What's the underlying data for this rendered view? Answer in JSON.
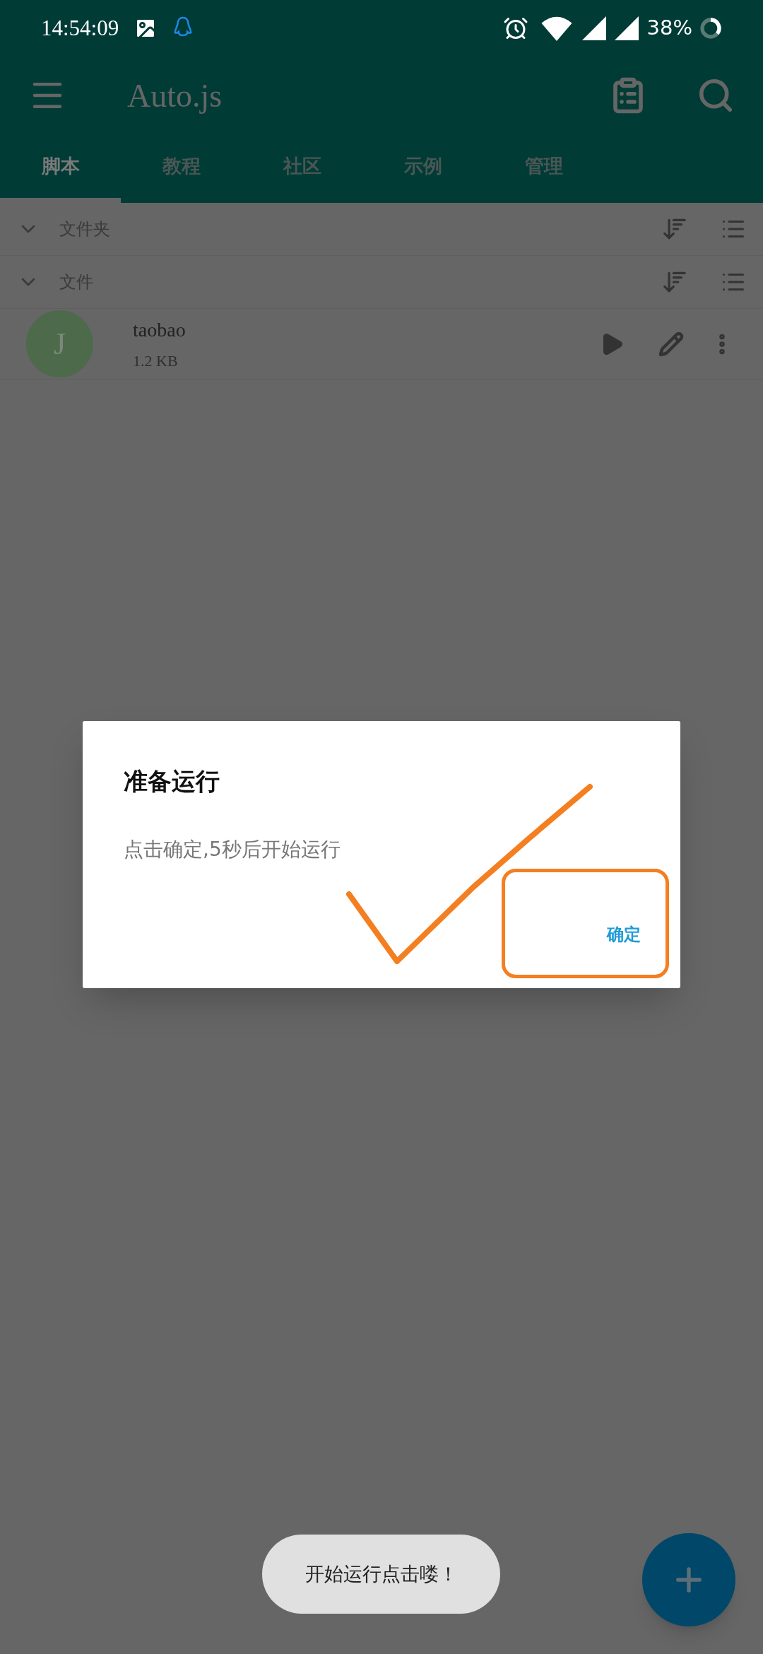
{
  "status_bar": {
    "time": "14:54:09",
    "battery": "38%"
  },
  "toolbar": {
    "title": "Auto.js"
  },
  "tabs": [
    {
      "label": "脚本",
      "selected": true
    },
    {
      "label": "教程",
      "selected": false
    },
    {
      "label": "社区",
      "selected": false
    },
    {
      "label": "示例",
      "selected": false
    },
    {
      "label": "管理",
      "selected": false
    }
  ],
  "sections": [
    {
      "title": "文件夹",
      "expanded": true
    },
    {
      "title": "文件",
      "expanded": true
    }
  ],
  "files": [
    {
      "name": "taobao",
      "size": "1.2 KB",
      "initial": "J"
    }
  ],
  "dialog": {
    "title": "准备运行",
    "message": "点击确定,5秒后开始运行",
    "buttons": [
      "确定"
    ]
  },
  "toast": "开始运行点击喽！"
}
